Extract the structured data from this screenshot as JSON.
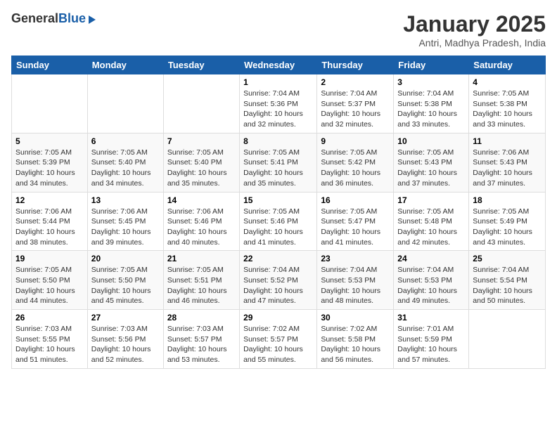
{
  "logo": {
    "general": "General",
    "blue": "Blue"
  },
  "title": {
    "month": "January 2025",
    "location": "Antri, Madhya Pradesh, India"
  },
  "days_of_week": [
    "Sunday",
    "Monday",
    "Tuesday",
    "Wednesday",
    "Thursday",
    "Friday",
    "Saturday"
  ],
  "weeks": [
    [
      {
        "num": "",
        "info": ""
      },
      {
        "num": "",
        "info": ""
      },
      {
        "num": "",
        "info": ""
      },
      {
        "num": "1",
        "info": "Sunrise: 7:04 AM\nSunset: 5:36 PM\nDaylight: 10 hours\nand 32 minutes."
      },
      {
        "num": "2",
        "info": "Sunrise: 7:04 AM\nSunset: 5:37 PM\nDaylight: 10 hours\nand 32 minutes."
      },
      {
        "num": "3",
        "info": "Sunrise: 7:04 AM\nSunset: 5:38 PM\nDaylight: 10 hours\nand 33 minutes."
      },
      {
        "num": "4",
        "info": "Sunrise: 7:05 AM\nSunset: 5:38 PM\nDaylight: 10 hours\nand 33 minutes."
      }
    ],
    [
      {
        "num": "5",
        "info": "Sunrise: 7:05 AM\nSunset: 5:39 PM\nDaylight: 10 hours\nand 34 minutes."
      },
      {
        "num": "6",
        "info": "Sunrise: 7:05 AM\nSunset: 5:40 PM\nDaylight: 10 hours\nand 34 minutes."
      },
      {
        "num": "7",
        "info": "Sunrise: 7:05 AM\nSunset: 5:40 PM\nDaylight: 10 hours\nand 35 minutes."
      },
      {
        "num": "8",
        "info": "Sunrise: 7:05 AM\nSunset: 5:41 PM\nDaylight: 10 hours\nand 35 minutes."
      },
      {
        "num": "9",
        "info": "Sunrise: 7:05 AM\nSunset: 5:42 PM\nDaylight: 10 hours\nand 36 minutes."
      },
      {
        "num": "10",
        "info": "Sunrise: 7:05 AM\nSunset: 5:43 PM\nDaylight: 10 hours\nand 37 minutes."
      },
      {
        "num": "11",
        "info": "Sunrise: 7:06 AM\nSunset: 5:43 PM\nDaylight: 10 hours\nand 37 minutes."
      }
    ],
    [
      {
        "num": "12",
        "info": "Sunrise: 7:06 AM\nSunset: 5:44 PM\nDaylight: 10 hours\nand 38 minutes."
      },
      {
        "num": "13",
        "info": "Sunrise: 7:06 AM\nSunset: 5:45 PM\nDaylight: 10 hours\nand 39 minutes."
      },
      {
        "num": "14",
        "info": "Sunrise: 7:06 AM\nSunset: 5:46 PM\nDaylight: 10 hours\nand 40 minutes."
      },
      {
        "num": "15",
        "info": "Sunrise: 7:05 AM\nSunset: 5:46 PM\nDaylight: 10 hours\nand 41 minutes."
      },
      {
        "num": "16",
        "info": "Sunrise: 7:05 AM\nSunset: 5:47 PM\nDaylight: 10 hours\nand 41 minutes."
      },
      {
        "num": "17",
        "info": "Sunrise: 7:05 AM\nSunset: 5:48 PM\nDaylight: 10 hours\nand 42 minutes."
      },
      {
        "num": "18",
        "info": "Sunrise: 7:05 AM\nSunset: 5:49 PM\nDaylight: 10 hours\nand 43 minutes."
      }
    ],
    [
      {
        "num": "19",
        "info": "Sunrise: 7:05 AM\nSunset: 5:50 PM\nDaylight: 10 hours\nand 44 minutes."
      },
      {
        "num": "20",
        "info": "Sunrise: 7:05 AM\nSunset: 5:50 PM\nDaylight: 10 hours\nand 45 minutes."
      },
      {
        "num": "21",
        "info": "Sunrise: 7:05 AM\nSunset: 5:51 PM\nDaylight: 10 hours\nand 46 minutes."
      },
      {
        "num": "22",
        "info": "Sunrise: 7:04 AM\nSunset: 5:52 PM\nDaylight: 10 hours\nand 47 minutes."
      },
      {
        "num": "23",
        "info": "Sunrise: 7:04 AM\nSunset: 5:53 PM\nDaylight: 10 hours\nand 48 minutes."
      },
      {
        "num": "24",
        "info": "Sunrise: 7:04 AM\nSunset: 5:53 PM\nDaylight: 10 hours\nand 49 minutes."
      },
      {
        "num": "25",
        "info": "Sunrise: 7:04 AM\nSunset: 5:54 PM\nDaylight: 10 hours\nand 50 minutes."
      }
    ],
    [
      {
        "num": "26",
        "info": "Sunrise: 7:03 AM\nSunset: 5:55 PM\nDaylight: 10 hours\nand 51 minutes."
      },
      {
        "num": "27",
        "info": "Sunrise: 7:03 AM\nSunset: 5:56 PM\nDaylight: 10 hours\nand 52 minutes."
      },
      {
        "num": "28",
        "info": "Sunrise: 7:03 AM\nSunset: 5:57 PM\nDaylight: 10 hours\nand 53 minutes."
      },
      {
        "num": "29",
        "info": "Sunrise: 7:02 AM\nSunset: 5:57 PM\nDaylight: 10 hours\nand 55 minutes."
      },
      {
        "num": "30",
        "info": "Sunrise: 7:02 AM\nSunset: 5:58 PM\nDaylight: 10 hours\nand 56 minutes."
      },
      {
        "num": "31",
        "info": "Sunrise: 7:01 AM\nSunset: 5:59 PM\nDaylight: 10 hours\nand 57 minutes."
      },
      {
        "num": "",
        "info": ""
      }
    ]
  ]
}
